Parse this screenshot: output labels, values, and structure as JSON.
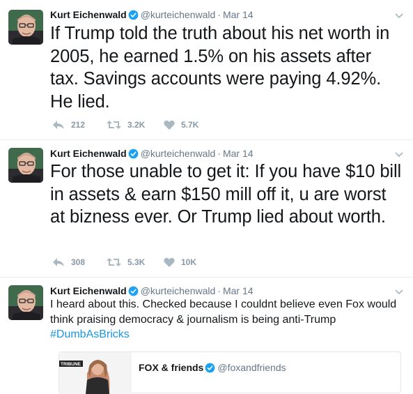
{
  "tweets": [
    {
      "author_name": "Kurt Eichenwald",
      "handle": "@kurteichenwald",
      "separator": "·",
      "time": "Mar 14",
      "text": "If Trump told the truth about his net worth in 2005, he earned 1.5% on his assets after tax. Savings accounts were paying 4.92%. He lied.",
      "replies": "212",
      "retweets": "3.2K",
      "likes": "5.7K"
    },
    {
      "author_name": "Kurt Eichenwald",
      "handle": "@kurteichenwald",
      "separator": "·",
      "time": "Mar 14",
      "text": "For those unable to get it: If you have $10 bill in assets & earn $150 mill off it, u are worst at bizness ever. Or Trump lied about worth.",
      "replies": "308",
      "retweets": "5.3K",
      "likes": "10K"
    },
    {
      "author_name": "Kurt Eichenwald",
      "handle": "@kurteichenwald",
      "separator": "·",
      "time": "Mar 14",
      "text": "I heard about this. Checked because I couldnt believe even Fox would think praising democracy & journalism is being anti-Trump",
      "hashtag": "#DumbAsBricks",
      "quoted": {
        "author_name": "FOX & friends",
        "handle": "@foxandfriends",
        "thumb_label": "TRIBUNE"
      }
    }
  ],
  "colors": {
    "verified": "#1da1f2",
    "hashtag": "#1b95e0",
    "action_gray": "#8899a6"
  },
  "icons": [
    "reply-icon",
    "retweet-icon",
    "like-icon",
    "verified-badge-icon",
    "chevron-down-icon"
  ]
}
